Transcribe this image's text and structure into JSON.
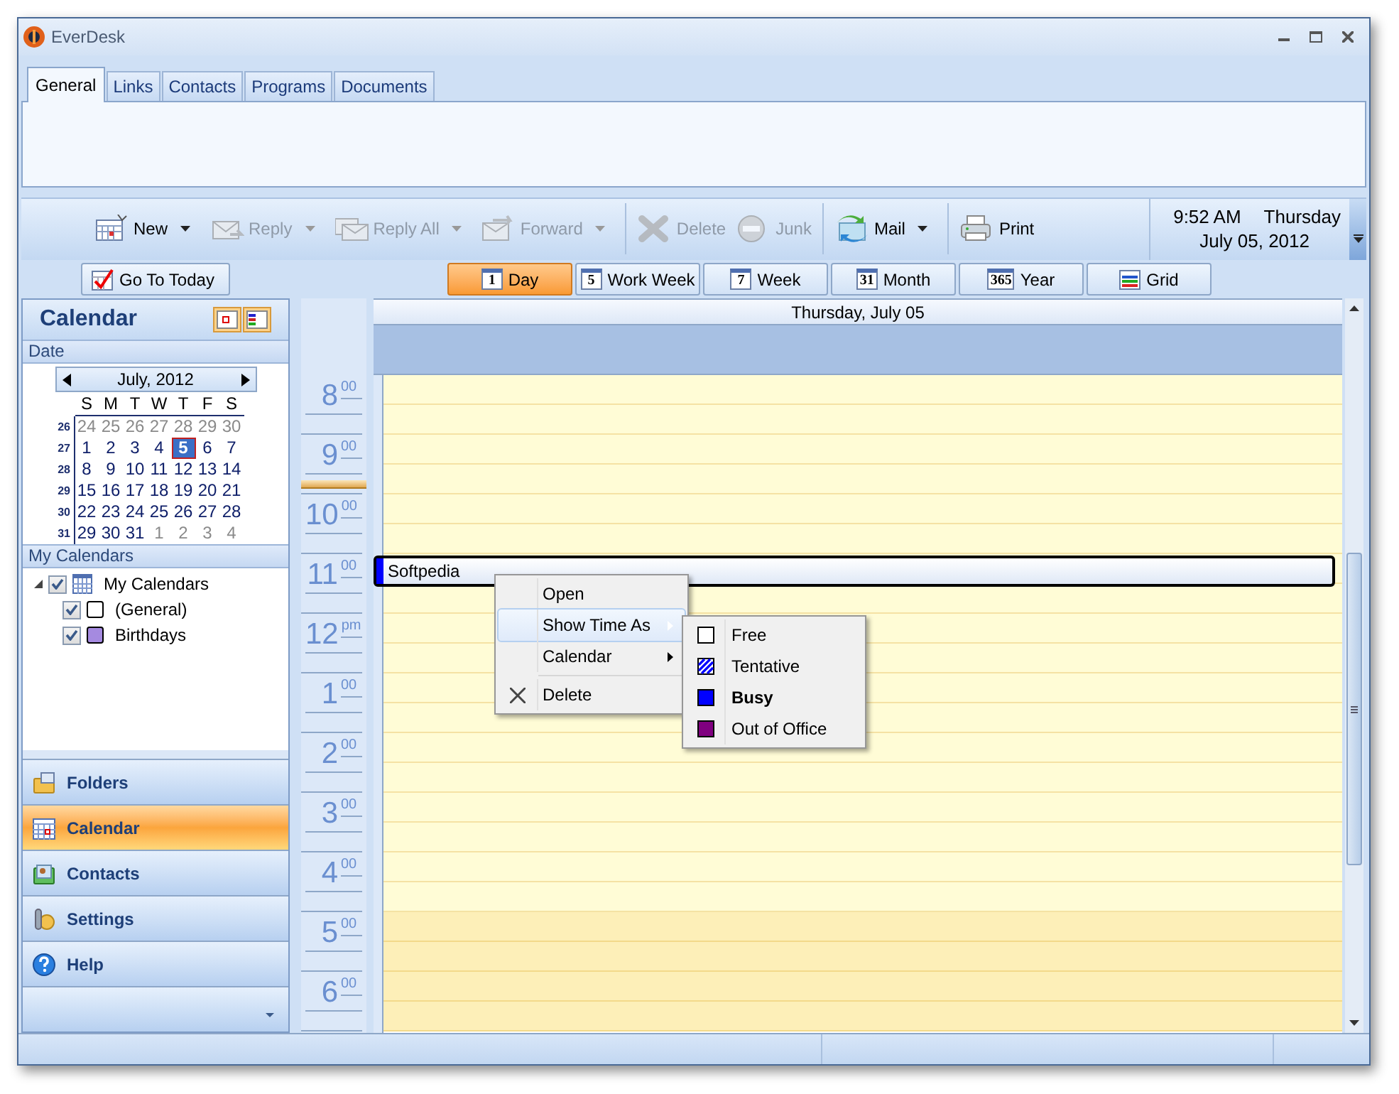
{
  "window": {
    "title": "EverDesk"
  },
  "tabs": [
    {
      "label": "General",
      "selected": true
    },
    {
      "label": "Links",
      "selected": false
    },
    {
      "label": "Contacts",
      "selected": false
    },
    {
      "label": "Programs",
      "selected": false
    },
    {
      "label": "Documents",
      "selected": false
    }
  ],
  "toolbar": {
    "groups": [
      [
        {
          "label": "New",
          "disabled": false,
          "dropdown": true
        },
        {
          "label": "Reply",
          "disabled": true,
          "dropdown": true
        },
        {
          "label": "Reply All",
          "disabled": true,
          "dropdown": true
        },
        {
          "label": "Forward",
          "disabled": true,
          "dropdown": true
        }
      ],
      [
        {
          "label": "Delete",
          "disabled": true,
          "dropdown": false
        },
        {
          "label": "Junk",
          "disabled": true,
          "dropdown": false
        }
      ],
      [
        {
          "label": "Mail",
          "disabled": false,
          "dropdown": true
        }
      ],
      [
        {
          "label": "Print",
          "disabled": false,
          "dropdown": false
        }
      ]
    ],
    "clock": {
      "time": "9:52 AM",
      "weekday": "Thursday",
      "date": "July 05, 2012"
    }
  },
  "go_to_today": "Go To Today",
  "views": [
    {
      "label": "Day",
      "icon_text": "1",
      "selected": true
    },
    {
      "label": "Work Week",
      "icon_text": "5",
      "selected": false
    },
    {
      "label": "Week",
      "icon_text": "7",
      "selected": false
    },
    {
      "label": "Month",
      "icon_text": "31",
      "selected": false
    },
    {
      "label": "Year",
      "icon_text": "365",
      "selected": false
    },
    {
      "label": "Grid",
      "selected": false
    }
  ],
  "sidebar": {
    "title": "Calendar",
    "date_section": "Date",
    "mini_calendar": {
      "month": "July, 2012",
      "weekdays": [
        "S",
        "M",
        "T",
        "W",
        "T",
        "F",
        "S"
      ],
      "weeks": [
        {
          "week": "26",
          "days": [
            {
              "day": "24",
              "other_month": true,
              "selected": false
            },
            {
              "day": "25",
              "other_month": true,
              "selected": false
            },
            {
              "day": "26",
              "other_month": true,
              "selected": false
            },
            {
              "day": "27",
              "other_month": true,
              "selected": false
            },
            {
              "day": "28",
              "other_month": true,
              "selected": false
            },
            {
              "day": "29",
              "other_month": true,
              "selected": false
            },
            {
              "day": "30",
              "other_month": true,
              "selected": false
            }
          ]
        },
        {
          "week": "27",
          "days": [
            {
              "day": "1",
              "other_month": false,
              "selected": false
            },
            {
              "day": "2",
              "other_month": false,
              "selected": false
            },
            {
              "day": "3",
              "other_month": false,
              "selected": false
            },
            {
              "day": "4",
              "other_month": false,
              "selected": false
            },
            {
              "day": "5",
              "other_month": false,
              "selected": true
            },
            {
              "day": "6",
              "other_month": false,
              "selected": false
            },
            {
              "day": "7",
              "other_month": false,
              "selected": false
            }
          ]
        },
        {
          "week": "28",
          "days": [
            {
              "day": "8",
              "other_month": false,
              "selected": false
            },
            {
              "day": "9",
              "other_month": false,
              "selected": false
            },
            {
              "day": "10",
              "other_month": false,
              "selected": false
            },
            {
              "day": "11",
              "other_month": false,
              "selected": false
            },
            {
              "day": "12",
              "other_month": false,
              "selected": false
            },
            {
              "day": "13",
              "other_month": false,
              "selected": false
            },
            {
              "day": "14",
              "other_month": false,
              "selected": false
            }
          ]
        },
        {
          "week": "29",
          "days": [
            {
              "day": "15",
              "other_month": false,
              "selected": false
            },
            {
              "day": "16",
              "other_month": false,
              "selected": false
            },
            {
              "day": "17",
              "other_month": false,
              "selected": false
            },
            {
              "day": "18",
              "other_month": false,
              "selected": false
            },
            {
              "day": "19",
              "other_month": false,
              "selected": false
            },
            {
              "day": "20",
              "other_month": false,
              "selected": false
            },
            {
              "day": "21",
              "other_month": false,
              "selected": false
            }
          ]
        },
        {
          "week": "30",
          "days": [
            {
              "day": "22",
              "other_month": false,
              "selected": false
            },
            {
              "day": "23",
              "other_month": false,
              "selected": false
            },
            {
              "day": "24",
              "other_month": false,
              "selected": false
            },
            {
              "day": "25",
              "other_month": false,
              "selected": false
            },
            {
              "day": "26",
              "other_month": false,
              "selected": false
            },
            {
              "day": "27",
              "other_month": false,
              "selected": false
            },
            {
              "day": "28",
              "other_month": false,
              "selected": false
            }
          ]
        },
        {
          "week": "31",
          "days": [
            {
              "day": "29",
              "other_month": false,
              "selected": false
            },
            {
              "day": "30",
              "other_month": false,
              "selected": false
            },
            {
              "day": "31",
              "other_month": false,
              "selected": false
            },
            {
              "day": "1",
              "other_month": true,
              "selected": false
            },
            {
              "day": "2",
              "other_month": true,
              "selected": false
            },
            {
              "day": "3",
              "other_month": true,
              "selected": false
            },
            {
              "day": "4",
              "other_month": true,
              "selected": false
            }
          ]
        }
      ]
    },
    "calendars_section": "My Calendars",
    "tree": [
      {
        "label": "My Calendars",
        "checked": true,
        "expanded": true,
        "children": [
          {
            "label": "(General)",
            "checked": true,
            "color": "#ffffff"
          },
          {
            "label": "Birthdays",
            "checked": true,
            "color": "#a58ae0"
          }
        ]
      }
    ],
    "nav": [
      {
        "label": "Folders",
        "selected": false
      },
      {
        "label": "Calendar",
        "selected": true
      },
      {
        "label": "Contacts",
        "selected": false
      },
      {
        "label": "Settings",
        "selected": false
      },
      {
        "label": "Help",
        "selected": false
      }
    ]
  },
  "day_view": {
    "header": "Thursday, July 05",
    "time_slots": [
      {
        "hour": "8",
        "suffix": "00",
        "current": false,
        "after_hours": false
      },
      {
        "hour": "9",
        "suffix": "00",
        "current": true,
        "after_hours": false
      },
      {
        "hour": "10",
        "suffix": "00",
        "current": false,
        "after_hours": false
      },
      {
        "hour": "11",
        "suffix": "00",
        "current": false,
        "after_hours": false,
        "events": [
          {
            "title": "Softpedia",
            "selected": true
          }
        ]
      },
      {
        "hour": "12",
        "suffix": "pm",
        "current": false,
        "after_hours": false
      },
      {
        "hour": "1",
        "suffix": "00",
        "current": false,
        "after_hours": false
      },
      {
        "hour": "2",
        "suffix": "00",
        "current": false,
        "after_hours": false
      },
      {
        "hour": "3",
        "suffix": "00",
        "current": false,
        "after_hours": false
      },
      {
        "hour": "4",
        "suffix": "00",
        "current": false,
        "after_hours": false
      },
      {
        "hour": "5",
        "suffix": "00",
        "current": false,
        "after_hours": true
      },
      {
        "hour": "6",
        "suffix": "00",
        "current": false,
        "after_hours": true
      }
    ]
  },
  "context_menu": {
    "items": [
      {
        "label": "Open",
        "kind": "item",
        "highlighted": false
      },
      {
        "label": "Show Time As",
        "kind": "submenu",
        "highlighted": true
      },
      {
        "label": "Calendar",
        "kind": "submenu",
        "highlighted": false
      },
      {
        "label": "Delete",
        "kind": "delete",
        "highlighted": false
      }
    ],
    "submenu": [
      {
        "label": "Free",
        "kind": "solid",
        "color": "#ffffff",
        "selected": false
      },
      {
        "label": "Tentative",
        "kind": "hatched",
        "color": "#0000ff",
        "selected": false
      },
      {
        "label": "Busy",
        "kind": "solid",
        "color": "#0000ff",
        "selected": true
      },
      {
        "label": "Out of Office",
        "kind": "solid",
        "color": "#800080",
        "selected": false
      }
    ]
  }
}
